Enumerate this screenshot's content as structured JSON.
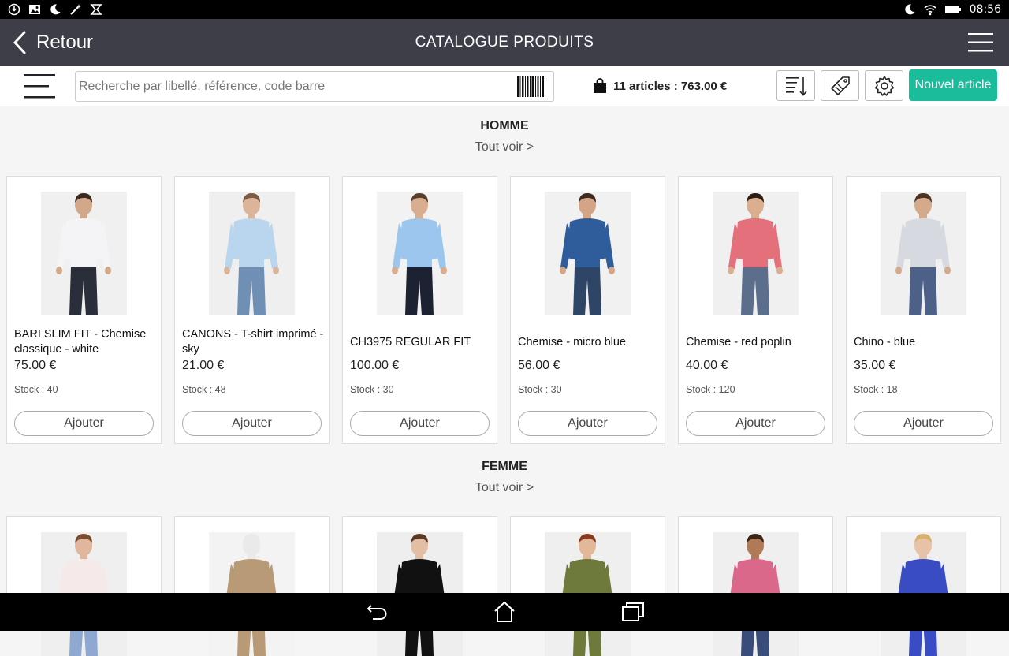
{
  "statusbar": {
    "left_icons": [
      "sync-icon",
      "image-icon",
      "moon-icon",
      "magic-wand-icon",
      "gesture-icon"
    ],
    "right_icons": [
      "moon-icon",
      "wifi-icon",
      "battery-icon"
    ],
    "time": "08:56"
  },
  "appbar": {
    "back_label": "Retour",
    "title": "CATALOGUE PRODUITS"
  },
  "toolbar": {
    "search_placeholder": "Recherche par libellé, référence, code barre",
    "search_value": "",
    "cart_label": "11 articles : 763.00 €",
    "new_item_label": "Nouvel article"
  },
  "colors": {
    "accent": "#1abc9c",
    "appbar": "#3e3e48",
    "background": "#f5f5f5"
  },
  "sections": {
    "homme": {
      "title": "HOMME",
      "see_all": "Tout voir >",
      "products": [
        {
          "name": "BARI SLIM FIT - Chemise classique - white",
          "price": "75.00 €",
          "stock": "Stock : 40",
          "add": "Ajouter",
          "shirt": "#f4f4f6",
          "pants": "#2a2d3a",
          "skin": "#d2a88a",
          "hair": "#3a2a20",
          "bg": "#f0f0f0"
        },
        {
          "name": "CANONS - T-shirt imprimé - sky",
          "price": "21.00 €",
          "stock": "Stock : 48",
          "add": "Ajouter",
          "shirt": "#b9d6ee",
          "pants": "#6f8fb5",
          "skin": "#dcb49a",
          "hair": "#7a5c45",
          "bg": "#efefef"
        },
        {
          "name": "CH3975 REGULAR FIT",
          "price": "100.00 €",
          "stock": "Stock : 30",
          "add": "Ajouter",
          "shirt": "#9cc6ee",
          "pants": "#1d2233",
          "skin": "#d9ad8f",
          "hair": "#5a3f2c",
          "bg": "#f2f2f2"
        },
        {
          "name": "Chemise - micro blue",
          "price": "56.00 €",
          "stock": "Stock : 30",
          "add": "Ajouter",
          "shirt": "#2f5d9c",
          "pants": "#2e4565",
          "skin": "#d4a487",
          "hair": "#3d2b1f",
          "bg": "#f1f1f1"
        },
        {
          "name": "Chemise - red poplin",
          "price": "40.00 €",
          "stock": "Stock : 120",
          "add": "Ajouter",
          "shirt": "#e3707a",
          "pants": "#5b6e8c",
          "skin": "#dcae90",
          "hair": "#2b1d14",
          "bg": "#f0f0f0"
        },
        {
          "name": "Chino - blue",
          "price": "35.00 €",
          "stock": "Stock : 18",
          "add": "Ajouter",
          "shirt": "#d6d9e0",
          "pants": "#4d6088",
          "skin": "#d5a98b",
          "hair": "#4b3423",
          "bg": "#f0f0f0"
        }
      ]
    },
    "femme": {
      "title": "FEMME",
      "see_all": "Tout voir >",
      "products": [
        {
          "shirt": "#f6e9ea",
          "pants": "#8fa8d2",
          "skin": "#e0b79c",
          "hair": "#7a4b2c",
          "bg": "#efefef"
        },
        {
          "shirt": "#b89b76",
          "pants": "#b89b76",
          "skin": "#eaeaea",
          "hair": "#eaeaea",
          "bg": "#f3f3f3"
        },
        {
          "shirt": "#111111",
          "pants": "#111111",
          "skin": "#e2bea4",
          "hair": "#5a3a22",
          "bg": "#eeeeee"
        },
        {
          "shirt": "#6d7a3c",
          "pants": "#6d7a3c",
          "skin": "#e3b79a",
          "hair": "#8a3a1c",
          "bg": "#efefef"
        },
        {
          "shirt": "#d9688a",
          "pants": "#3a4c7a",
          "skin": "#b07a58",
          "hair": "#3a2414",
          "bg": "#efefef"
        },
        {
          "shirt": "#3a4cc4",
          "pants": "#3a4cc4",
          "skin": "#e8c2a6",
          "hair": "#d8b070",
          "bg": "#efefef"
        }
      ]
    }
  },
  "navbar": {
    "icons": [
      "back-arrow-icon",
      "home-icon",
      "recent-apps-icon"
    ]
  }
}
